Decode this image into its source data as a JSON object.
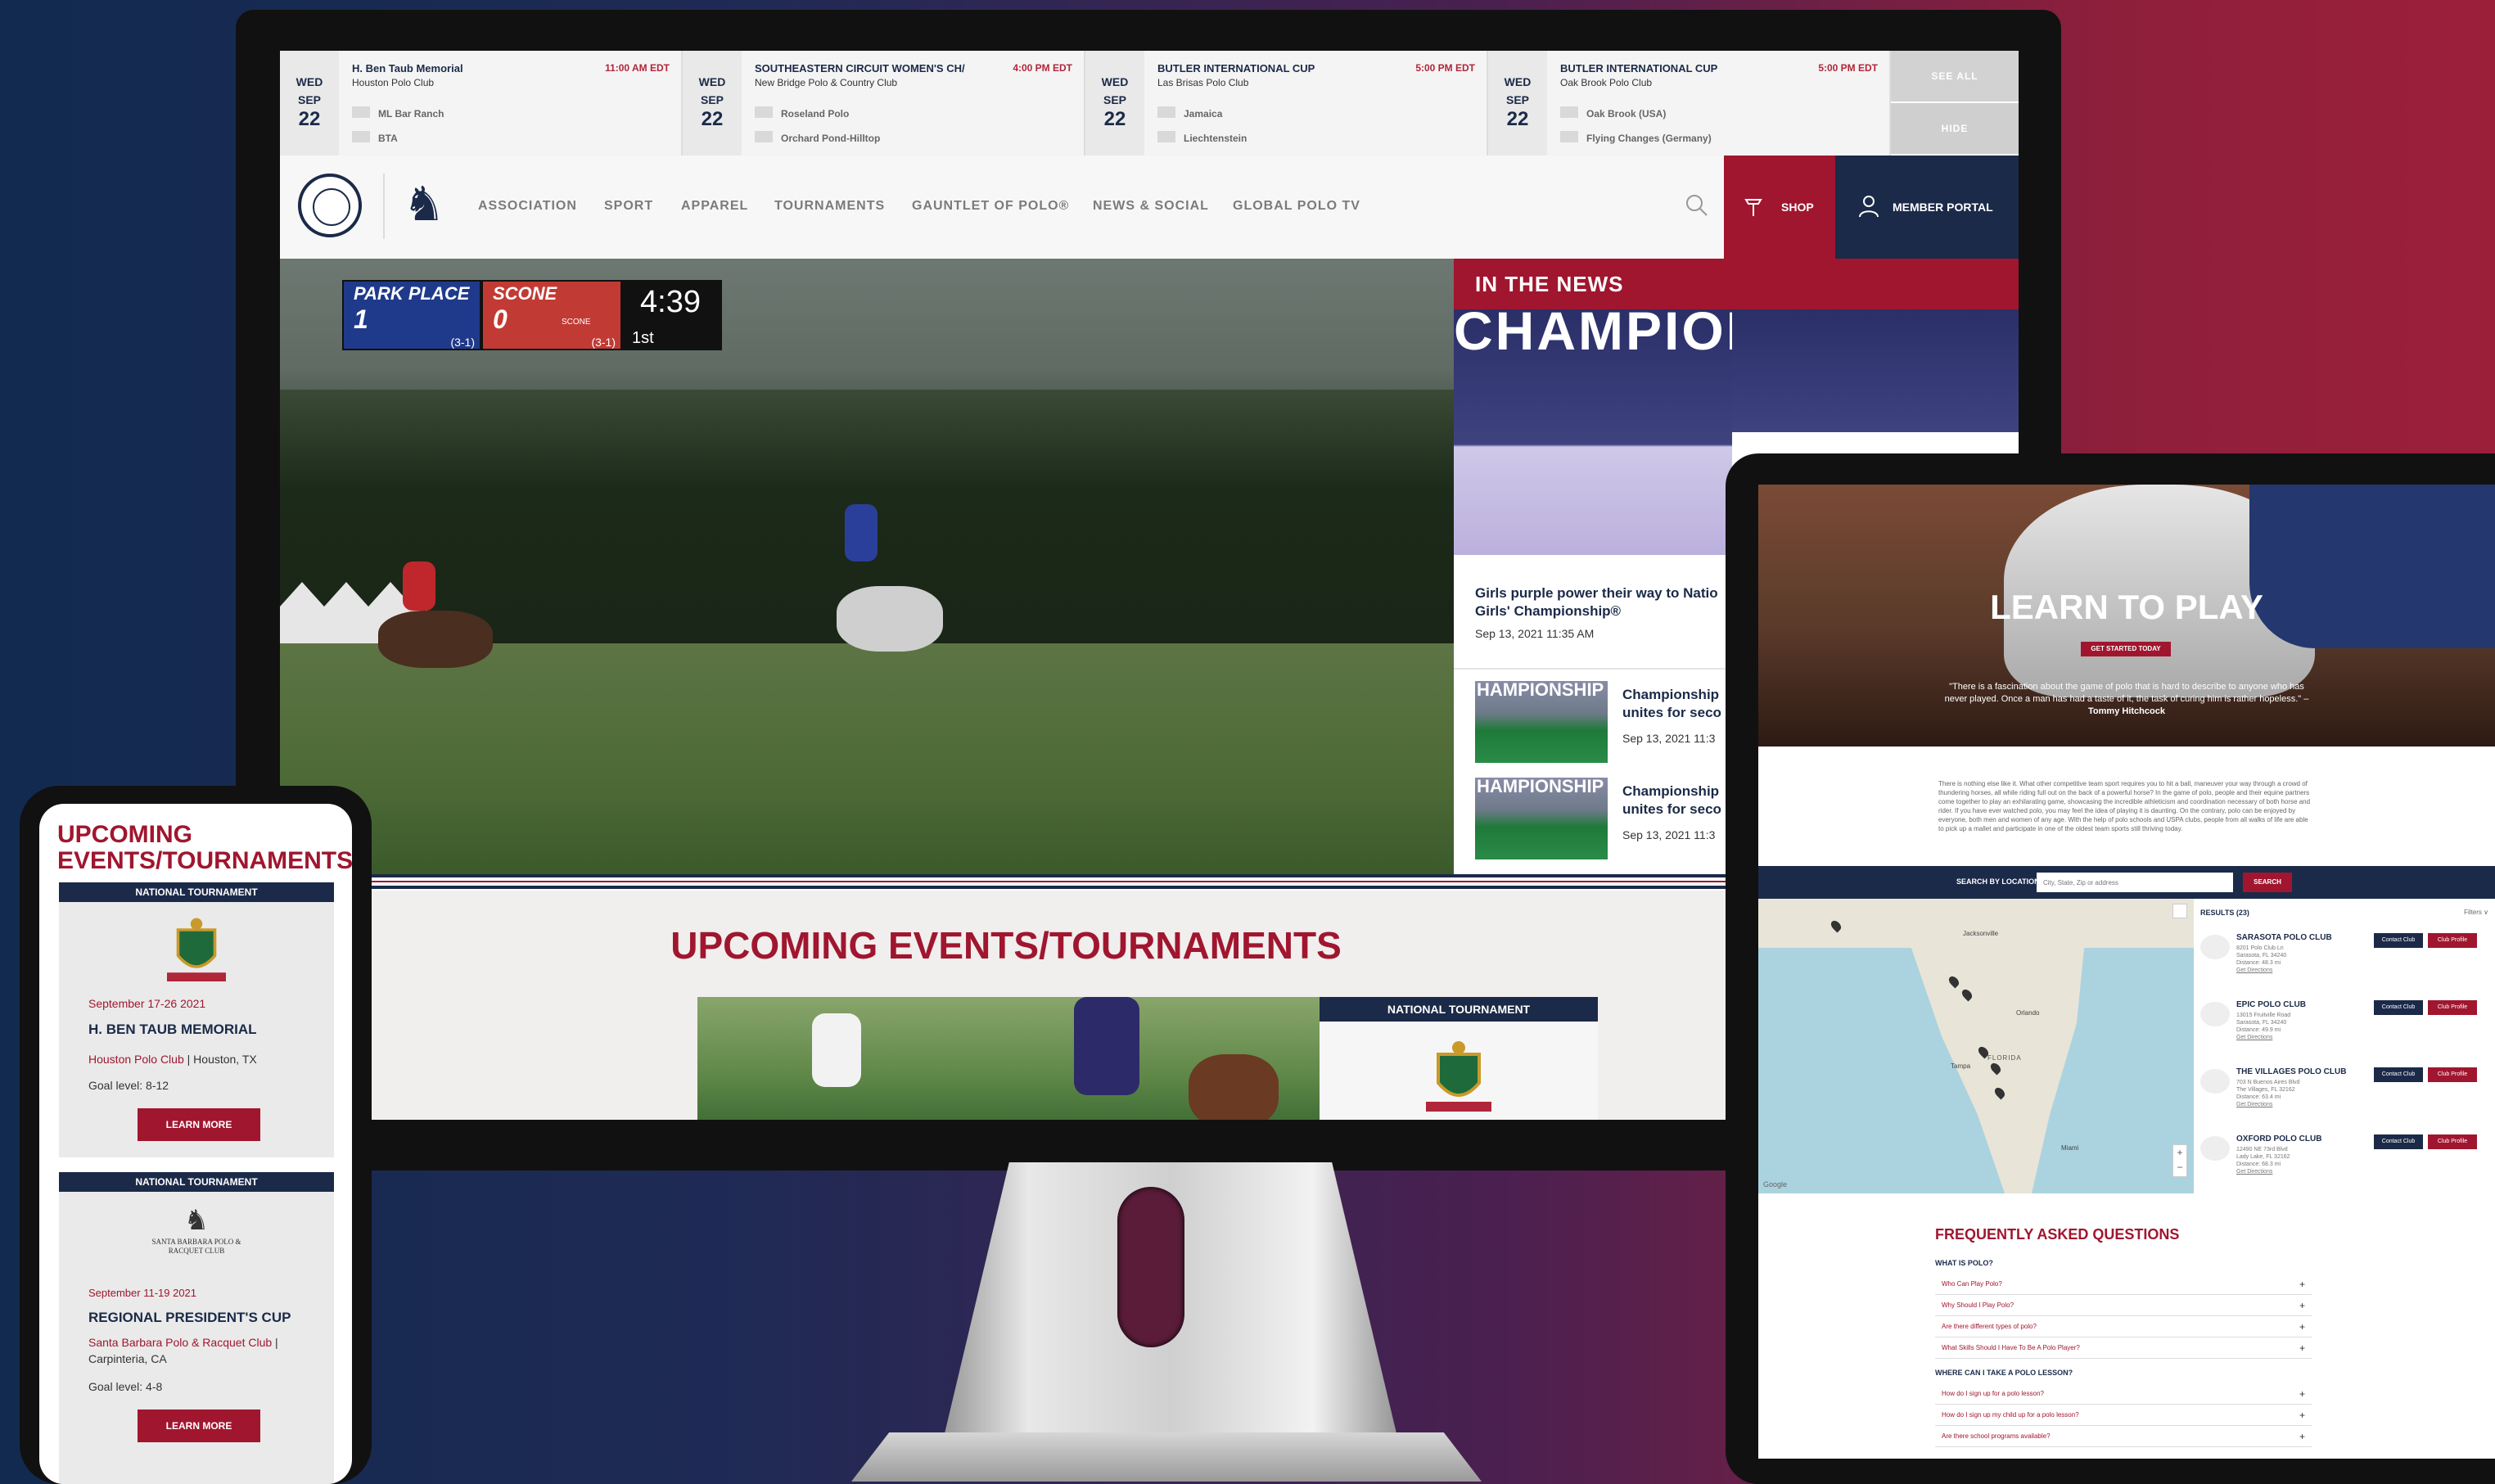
{
  "schedule": [
    {
      "dow": "WED",
      "mon": "SEP",
      "day": "22",
      "title": "H. Ben Taub Memorial",
      "time": "11:00 AM EDT",
      "club": "Houston Polo Club",
      "team1": "ML Bar Ranch",
      "team2": "BTA"
    },
    {
      "dow": "WED",
      "mon": "SEP",
      "day": "22",
      "title": "SOUTHEASTERN CIRCUIT WOMEN'S CH/",
      "time": "4:00 PM EDT",
      "club": "New Bridge Polo & Country Club",
      "team1": "Roseland Polo",
      "team2": "Orchard Pond-Hilltop"
    },
    {
      "dow": "WED",
      "mon": "SEP",
      "day": "22",
      "title": "BUTLER INTERNATIONAL CUP",
      "time": "5:00 PM EDT",
      "club": "Las Brisas Polo Club",
      "team1": "Jamaica",
      "team2": "Liechtenstein"
    },
    {
      "dow": "WED",
      "mon": "SEP",
      "day": "22",
      "title": "BUTLER INTERNATIONAL CUP",
      "time": "5:00 PM EDT",
      "club": "Oak Brook Polo Club",
      "team1": "Oak Brook (USA)",
      "team2": "Flying Changes (Germany)"
    }
  ],
  "schedule_buttons": {
    "see_all": "SEE ALL",
    "hide": "HIDE"
  },
  "nav": {
    "items": [
      "ASSOCIATION",
      "SPORT",
      "APPAREL",
      "TOURNAMENTS",
      "GAUNTLET OF POLO®",
      "NEWS & SOCIAL",
      "GLOBAL POLO TV"
    ],
    "shop": "SHOP",
    "portal": "MEMBER PORTAL"
  },
  "scoreboard": {
    "team1": "PARK PLACE",
    "score1": "1",
    "team2": "SCONE",
    "score2": "0",
    "record1": "(3-1)",
    "record2": "(3-1)",
    "clock": "4:39",
    "period": "1st",
    "sponsor": "SCONE"
  },
  "news": {
    "header": "IN THE NEWS",
    "banner": "CHAMPIONSHIP",
    "main_title": "Girls purple power their way to Natio Girls' Championship®",
    "main_date": "Sep 13, 2021 11:35 AM",
    "items": [
      {
        "title": "Championship unites for seco",
        "date": "Sep 13, 2021 11:3",
        "thumb": "HAMPIONSHIP"
      },
      {
        "title": "Championship unites for seco",
        "date": "Sep 13, 2021 11:3",
        "thumb": "HAMPIONSHIP"
      }
    ]
  },
  "events": {
    "title": "UPCOMING EVENTS/TOURNAMENTS",
    "card_head": "NATIONAL TOURNAMENT"
  },
  "phone": {
    "title": "UPCOMING EVENTS/TOURNAMENTS",
    "cards": [
      {
        "head": "NATIONAL TOURNAMENT",
        "date": "September 17-26 2021",
        "name": "H. BEN TAUB MEMORIAL",
        "club": "Houston Polo Club",
        "location": " | Houston, TX",
        "goal": "Goal level: 8-12",
        "btn": "LEARN MORE"
      },
      {
        "head": "NATIONAL TOURNAMENT",
        "date": "September 11-19 2021",
        "name": "REGIONAL PRESIDENT'S  CUP",
        "club": "Santa Barbara Polo & Racquet Club",
        "location": " | Carpinteria, CA",
        "goal": "Goal level: 4-8",
        "btn": "LEARN MORE",
        "logo": "SANTA BARBARA POLO & RACQUET CLUB"
      }
    ]
  },
  "tablet": {
    "hero_title": "LEARN TO PLAY",
    "hero_btn": "GET STARTED TODAY",
    "quote": "\"There is a fascination about the game of polo that is hard to describe to anyone who has never played. Once a man has had a taste of it, the task of curing him is rather hopeless.\" – ",
    "quote_author": "Tommy Hitchcock",
    "para": "There is nothing else like it. What other competitive team sport requires you to hit a ball, maneuver your way through a crowd of thundering horses, all while riding full out on the back of a powerful horse? In the game of polo, people and their equine partners come together to play an exhilarating game, showcasing the incredible athleticism and coordination necessary of both horse and rider. If you have ever watched polo, you may feel the idea of playing it is daunting. On the contrary, polo can be enjoyed by everyone, both men and women of any age. With the help of polo schools and USPA clubs, people from all walks of life are able to pick up a mallet and participate in one of the oldest team sports still thriving today.",
    "search_label": "SEARCH BY LOCATION:",
    "search_placeholder": "City, State, Zip or address",
    "search_btn": "SEARCH",
    "results_label": "RESULTS (23)",
    "filters": "Filters ∨",
    "results": [
      {
        "name": "SARASOTA POLO CLUB",
        "addr": "8201 Polo Club Ln|Sarasota, FL 34240|Distance: 48.3 mi|Get Directions"
      },
      {
        "name": "EPIC POLO CLUB",
        "addr": "13015 Fruitville Road|Sarasota, FL 34240|Distance: 49.9 mi|Get Directions"
      },
      {
        "name": "THE VILLAGES POLO CLUB",
        "addr": "703 N Buenos Aires Blvd|The Villages, FL 32162|Distance: 63.4 mi|Get Directions"
      },
      {
        "name": "OXFORD POLO CLUB",
        "addr": "12490 NE 73rd Blvd|Lady Lake, FL 32162|Distance: 68.3 mi|Get Directions"
      }
    ],
    "btn_contact": "Contact Club",
    "btn_profile": "Club Profile",
    "map_labels": [
      "Jacksonville",
      "FLORIDA",
      "Tampa",
      "Miami",
      "Orlando",
      "Google"
    ],
    "faq_title": "FREQUENTLY ASKED QUESTIONS",
    "faq": [
      {
        "section": "WHAT IS POLO?",
        "questions": [
          "Who Can Play Polo?",
          "Why Should I Play Polo?",
          "Are there different types of polo?",
          "What Skills Should I Have To Be A Polo Player?"
        ]
      },
      {
        "section": "WHERE CAN I TAKE A POLO LESSON?",
        "questions": [
          "How do I sign up for a polo lesson?",
          "How do I sign up my child up for a polo lesson?",
          "Are there school programs available?"
        ]
      }
    ]
  },
  "colors": {
    "red": "#a0162f",
    "navy": "#1b2a48"
  }
}
